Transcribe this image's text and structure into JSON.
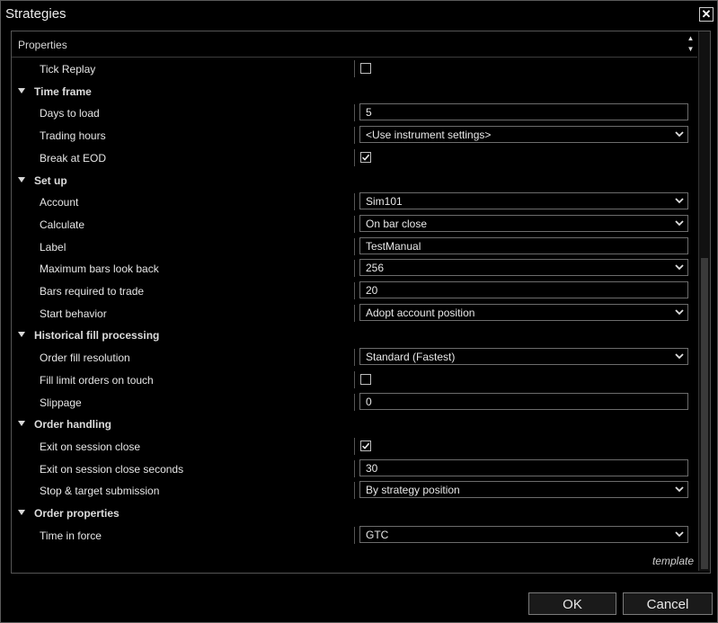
{
  "window": {
    "title": "Strategies",
    "close_glyph": "✕"
  },
  "panel": {
    "header": "Properties"
  },
  "rows": [
    {
      "type": "property",
      "label": "Tick Replay",
      "kind": "checkbox",
      "checked": false
    },
    {
      "type": "category",
      "label": "Time frame"
    },
    {
      "type": "property",
      "label": "Days to load",
      "kind": "text",
      "value": "5"
    },
    {
      "type": "property",
      "label": "Trading hours",
      "kind": "select",
      "value": "<Use instrument settings>"
    },
    {
      "type": "property",
      "label": "Break at EOD",
      "kind": "checkbox",
      "checked": true
    },
    {
      "type": "category",
      "label": "Set up"
    },
    {
      "type": "property",
      "label": "Account",
      "kind": "select",
      "value": "Sim101"
    },
    {
      "type": "property",
      "label": "Calculate",
      "kind": "select",
      "value": "On bar close"
    },
    {
      "type": "property",
      "label": "Label",
      "kind": "text",
      "value": "TestManual"
    },
    {
      "type": "property",
      "label": "Maximum bars look back",
      "kind": "select",
      "value": "256"
    },
    {
      "type": "property",
      "label": "Bars required to trade",
      "kind": "text",
      "value": "20"
    },
    {
      "type": "property",
      "label": "Start behavior",
      "kind": "select",
      "value": "Adopt account position"
    },
    {
      "type": "category",
      "label": "Historical fill processing"
    },
    {
      "type": "property",
      "label": "Order fill resolution",
      "kind": "select",
      "value": "Standard (Fastest)"
    },
    {
      "type": "property",
      "label": "Fill limit orders on touch",
      "kind": "checkbox",
      "checked": false
    },
    {
      "type": "property",
      "label": "Slippage",
      "kind": "text",
      "value": "0"
    },
    {
      "type": "category",
      "label": "Order handling"
    },
    {
      "type": "property",
      "label": "Exit on session close",
      "kind": "checkbox",
      "checked": true
    },
    {
      "type": "property",
      "label": "Exit on session close seconds",
      "kind": "text",
      "value": "30"
    },
    {
      "type": "property",
      "label": "Stop & target submission",
      "kind": "select",
      "value": "By strategy position"
    },
    {
      "type": "category",
      "label": "Order properties"
    },
    {
      "type": "property",
      "label": "Time in force",
      "kind": "select",
      "value": "GTC"
    }
  ],
  "template_link": "template",
  "buttons": {
    "ok": "OK",
    "cancel": "Cancel"
  },
  "icons": {
    "close": "close-icon",
    "expander": "triangle-down-icon",
    "dropdown": "chevron-down-icon",
    "check": "checkmark-icon"
  }
}
